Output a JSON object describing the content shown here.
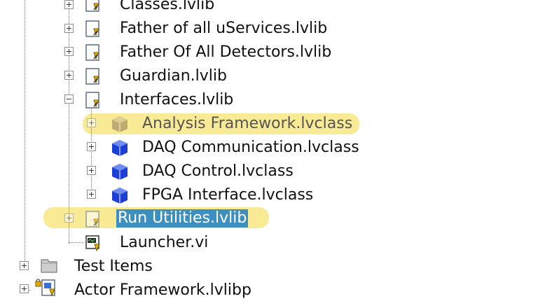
{
  "tree": {
    "items": [
      {
        "label": "Classes.lvlib"
      },
      {
        "label": "Father of all uServices.lvlib"
      },
      {
        "label": "Father Of All Detectors.lvlib"
      },
      {
        "label": "Guardian.lvlib"
      },
      {
        "label": "Interfaces.lvlib"
      },
      {
        "label": "Analysis Framework.lvclass"
      },
      {
        "label": "DAQ Communication.lvclass"
      },
      {
        "label": "DAQ Control.lvclass"
      },
      {
        "label": "FPGA Interface.lvclass"
      },
      {
        "label": "Run Utilities.lvlib"
      },
      {
        "label": "Launcher.vi"
      },
      {
        "label": "Test Items"
      },
      {
        "label": "Actor Framework.lvlibp"
      }
    ]
  },
  "colors": {
    "highlight": "#f7e57a",
    "selection": "#3d8fbf",
    "class_icon": "#1d3fd6"
  }
}
